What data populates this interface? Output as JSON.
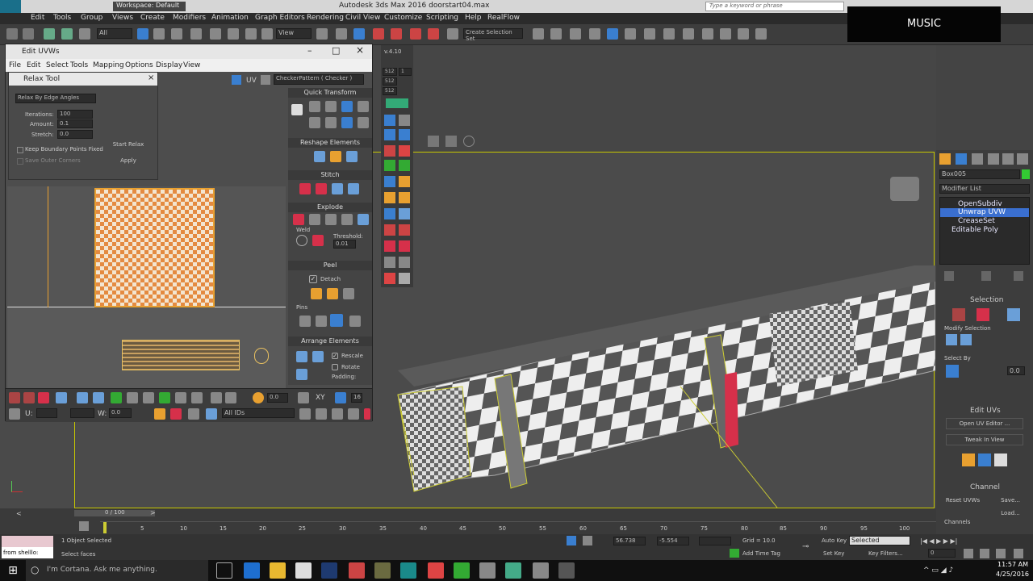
{
  "app": {
    "title": "Autodesk 3ds Max 2016    doorstart04.max",
    "workspace": "Workspace: Default",
    "search_placeholder": "Type a keyword or phrase"
  },
  "menu": [
    "Edit",
    "Tools",
    "Group",
    "Views",
    "Create",
    "Modifiers",
    "Animation",
    "Graph Editors",
    "Rendering",
    "Civil View",
    "Customize",
    "Scripting",
    "Help",
    "RealFlow"
  ],
  "toolbar": {
    "filter": "All",
    "coord": "View",
    "selection_set": "Create Selection Set"
  },
  "overlay": {
    "music": "MUSIC"
  },
  "edit_uvws": {
    "title": "Edit UVWs",
    "menu": [
      "File",
      "Edit",
      "Select",
      "Tools",
      "Mapping",
      "Options",
      "Display",
      "View"
    ],
    "uv_label": "UV",
    "checker": "CheckerPattern  ( Checker )",
    "relax": {
      "title": "Relax Tool",
      "method": "Relax By Edge Angles",
      "iterations_label": "Iterations:",
      "iterations": "100",
      "amount_label": "Amount:",
      "amount": "0.1",
      "stretch_label": "Stretch:",
      "stretch": "0.0",
      "keep_boundary": "Keep Boundary Points Fixed",
      "save_outer": "Save Outer Corners",
      "start": "Start Relax",
      "apply": "Apply"
    },
    "sections": {
      "quick_transform": "Quick Transform",
      "reshape": "Reshape Elements",
      "stitch": "Stitch",
      "explode": "Explode",
      "weld": "Weld",
      "threshold_label": "Threshold:",
      "threshold": "0.01",
      "peel": "Peel",
      "detach": "Detach",
      "pins": "Pins",
      "arrange": "Arrange Elements",
      "rescale": "Rescale",
      "rotate": "Rotate",
      "padding": "Padding:"
    },
    "bottom": {
      "val1": "0.0",
      "xy": "XY",
      "u_label": "U:",
      "w_label": "W:",
      "w_val": "0.0",
      "ids": "All IDs",
      "num": "16"
    }
  },
  "cmd_strip": {
    "version": "v.4.10",
    "a": "512",
    "b": "512",
    "c": "512",
    "d": "1"
  },
  "right_panel": {
    "object": "Box005",
    "modifier_list": "Modifier List",
    "stack": [
      "OpenSubdiv",
      "Unwrap UVW",
      "CreaseSet",
      "Editable Poly"
    ],
    "selection": "Selection",
    "modify_selection": "Modify Selection",
    "select_by": "Select By",
    "select_val": "0.0",
    "edit_uvs": "Edit UVs",
    "open_editor": "Open UV Editor ...",
    "tweak": "Tweak In View",
    "channel": "Channel",
    "reset": "Reset UVWs",
    "save": "Save...",
    "load": "Load...",
    "channels": "Channels"
  },
  "timeline": {
    "frame": "0 / 100",
    "ticks": [
      "5",
      "10",
      "15",
      "20",
      "25",
      "30",
      "35",
      "40",
      "45",
      "50",
      "55",
      "60",
      "65",
      "70",
      "75",
      "80",
      "85",
      "90",
      "95",
      "100"
    ]
  },
  "status": {
    "script": "from shelllo:",
    "selected": "1 Object Selected",
    "prompt": "Select faces",
    "x": "56.738",
    "y": "-5.554",
    "grid": "Grid = 10.0",
    "time_tag": "Add Time Tag",
    "auto_key": "Auto Key",
    "set_key": "Set Key",
    "selected_dd": "Selected",
    "key_filters": "Key Filters...",
    "frame": "0"
  },
  "taskbar": {
    "cortana": "I'm Cortana. Ask me anything.",
    "time": "11:57 AM",
    "date": "4/25/2016"
  }
}
